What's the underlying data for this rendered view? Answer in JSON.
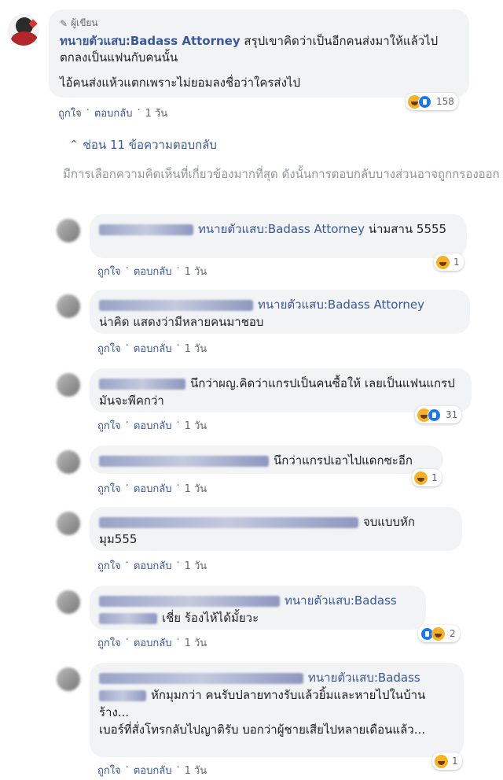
{
  "post": {
    "author_badge": "ผู้เขียน",
    "author_name": "ทนายตัวแสบ:Badass Attorney",
    "text_line1": " สรุปเขาคิดว่าเป็นอีกคนส่งมาให้แล้วไปตกลงเป็นแฟนกับคนนั้น",
    "text_line2": "ไอ้คนส่งแห้วแตกเพราะไม่ยอมลงชื่อว่าใครส่งไป",
    "reaction_count": "158",
    "like_label": "ถูกใจ",
    "reply_label": "ตอบกลับ",
    "time": "1 วัน"
  },
  "hide_replies": "ซ่อน 11 ข้อความตอบกลับ",
  "filter_note": "มีการเลือกความคิดเห็นที่เกี่ยวข้องมากที่สุด ดังนั้นการตอบกลับบางส่วนอาจถูกกรองออก",
  "replies": [
    {
      "mention": "ทนายตัวแสบ:Badass Attorney",
      "text": " น่ามสาน 5555",
      "reaction_count": "1",
      "like": "ถูกใจ",
      "reply": "ตอบกลับ",
      "time": "1 วัน"
    },
    {
      "mention": "ทนายตัวแสบ:Badass Attorney",
      "text": "น่าคิด แสดงว่ามีหลายคนมาชอบ",
      "reaction_count": "",
      "like": "ถูกใจ",
      "reply": "ตอบกลับ",
      "time": "1 วัน"
    },
    {
      "mention": "",
      "text": "นึกว่าผญ.คิดว่าแกรปเป็นคนซื้อให้ เลยเป็นแฟนแกรป มันจะพีคกว่า",
      "reaction_count": "31",
      "like": "ถูกใจ",
      "reply": "ตอบกลับ",
      "time": "1 วัน"
    },
    {
      "mention": "",
      "text": "นึกว่าแกรปเอาไปแดกซะอีก",
      "reaction_count": "1",
      "like": "ถูกใจ",
      "reply": "ตอบกลับ",
      "time": "1 วัน"
    },
    {
      "mention": "",
      "text": "จบแบบหักมุม555",
      "reaction_count": "",
      "like": "ถูกใจ",
      "reply": "ตอบกลับ",
      "time": "1 วัน"
    },
    {
      "mention": "ทนายตัวแสบ:Badass",
      "text": "เชี่ย ร้องไห้ได้มั้ยวะ",
      "reaction_count": "2",
      "like": "ถูกใจ",
      "reply": "ตอบกลับ",
      "time": "1 วัน"
    },
    {
      "mention": "ทนายตัวแสบ:Badass",
      "text": "หักมุมกว่า คนรับปลายทางรับแล้วยิ้มและหายไปในบ้านร้าง...",
      "text2": "เบอร์ที่สั่งโทรกลับไปญาติรับ บอกว่าผู้ชายเสียไปหลายเดือนแล้ว...",
      "reaction_count": "1",
      "like": "ถูกใจ",
      "reply": "ตอบกลับ",
      "time": "1 วัน"
    }
  ],
  "colors": {
    "link": "#385898",
    "bubble": "#f2f3f5",
    "meta": "#606770",
    "note": "#90949c"
  }
}
